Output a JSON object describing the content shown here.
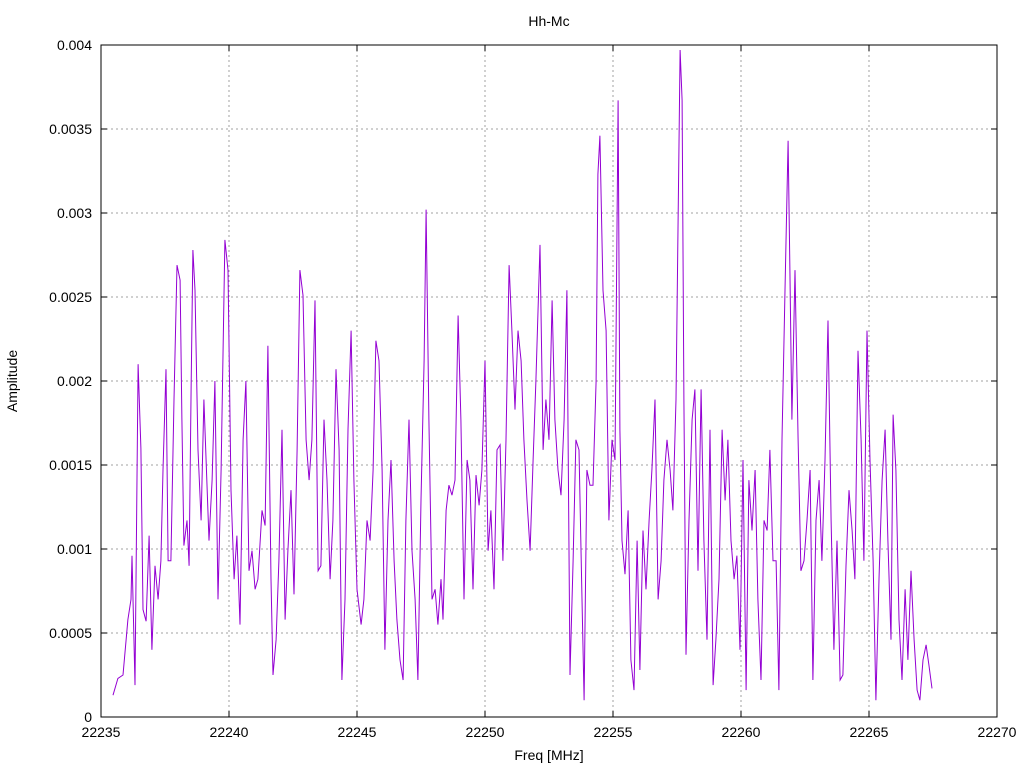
{
  "chart_data": {
    "type": "line",
    "title": "Hh-Mc",
    "xlabel": "Freq [MHz]",
    "ylabel": "Amplitude",
    "xlim": [
      22235,
      22270
    ],
    "ylim": [
      0,
      0.004
    ],
    "xticks": [
      22235,
      22240,
      22245,
      22250,
      22255,
      22260,
      22265,
      22270
    ],
    "yticks": [
      "0",
      "0.0005",
      "0.001",
      "0.0015",
      "0.002",
      "0.0025",
      "0.003",
      "0.0035",
      "0.004"
    ],
    "grid": true,
    "line_color": "#9400d3",
    "series": [
      {
        "name": "Hh-Mc",
        "x": [
          22235.47,
          22235.66,
          22235.86,
          22236.05,
          22236.17,
          22236.21,
          22236.33,
          22236.45,
          22236.56,
          22236.64,
          22236.76,
          22236.88,
          22236.99,
          22237.11,
          22237.23,
          22237.34,
          22237.42,
          22237.54,
          22237.62,
          22237.73,
          22237.85,
          22237.97,
          22238.09,
          22238.16,
          22238.24,
          22238.36,
          22238.44,
          22238.52,
          22238.59,
          22238.67,
          22238.79,
          22238.91,
          22239.02,
          22239.14,
          22239.22,
          22239.34,
          22239.45,
          22239.57,
          22239.69,
          22239.84,
          22239.96,
          22240.08,
          22240.2,
          22240.31,
          22240.43,
          22240.55,
          22240.66,
          22240.78,
          22240.9,
          22241.02,
          22241.13,
          22241.29,
          22241.41,
          22241.52,
          22241.64,
          22241.72,
          22241.84,
          22241.95,
          22242.07,
          22242.19,
          22242.3,
          22242.42,
          22242.54,
          22242.66,
          22242.77,
          22242.89,
          22243.01,
          22243.13,
          22243.24,
          22243.36,
          22243.48,
          22243.59,
          22243.71,
          22243.83,
          22243.95,
          22244.06,
          22244.18,
          22244.3,
          22244.41,
          22244.53,
          22244.65,
          22244.77,
          22244.88,
          22245.0,
          22245.16,
          22245.27,
          22245.39,
          22245.51,
          22245.63,
          22245.74,
          22245.86,
          22245.98,
          22246.09,
          22246.21,
          22246.33,
          22246.45,
          22246.56,
          22246.68,
          22246.8,
          22246.91,
          22247.03,
          22247.15,
          22247.27,
          22247.38,
          22247.5,
          22247.62,
          22247.7,
          22247.81,
          22247.93,
          22248.05,
          22248.16,
          22248.28,
          22248.36,
          22248.48,
          22248.59,
          22248.71,
          22248.83,
          22248.95,
          22249.06,
          22249.18,
          22249.3,
          22249.41,
          22249.53,
          22249.65,
          22249.77,
          22249.88,
          22250.0,
          22250.12,
          22250.23,
          22250.35,
          22250.47,
          22250.59,
          22250.7,
          22250.82,
          22250.94,
          22251.05,
          22251.17,
          22251.29,
          22251.41,
          22251.52,
          22251.64,
          22251.76,
          22251.88,
          22251.99,
          22252.15,
          22252.27,
          22252.38,
          22252.5,
          22252.62,
          22252.73,
          22252.85,
          22252.97,
          22253.09,
          22253.2,
          22253.32,
          22253.44,
          22253.55,
          22253.67,
          22253.79,
          22253.87,
          22253.98,
          22254.1,
          22254.22,
          22254.34,
          22254.41,
          22254.49,
          22254.61,
          22254.73,
          22254.84,
          22254.96,
          22255.08,
          22255.2,
          22255.27,
          22255.35,
          22255.47,
          22255.59,
          22255.7,
          22255.82,
          22255.94,
          22256.05,
          22256.17,
          22256.29,
          22256.41,
          22256.52,
          22256.64,
          22256.76,
          22256.88,
          22256.99,
          22257.11,
          22257.23,
          22257.34,
          22257.46,
          22257.62,
          22257.7,
          22257.77,
          22257.85,
          22257.97,
          22258.09,
          22258.2,
          22258.32,
          22258.44,
          22258.55,
          22258.67,
          22258.79,
          22258.91,
          22259.02,
          22259.14,
          22259.26,
          22259.38,
          22259.49,
          22259.61,
          22259.73,
          22259.84,
          22259.96,
          22260.08,
          22260.2,
          22260.31,
          22260.43,
          22260.55,
          22260.66,
          22260.78,
          22260.9,
          22261.02,
          22261.13,
          22261.25,
          22261.37,
          22261.48,
          22261.6,
          22261.72,
          22261.84,
          22261.91,
          22261.99,
          22262.11,
          22262.23,
          22262.34,
          22262.46,
          22262.58,
          22262.7,
          22262.81,
          22262.93,
          22263.05,
          22263.16,
          22263.28,
          22263.4,
          22263.52,
          22263.63,
          22263.75,
          22263.87,
          22263.98,
          22264.1,
          22264.22,
          22264.34,
          22264.45,
          22264.57,
          22264.69,
          22264.8,
          22264.92,
          22265.04,
          22265.16,
          22265.27,
          22265.39,
          22265.51,
          22265.63,
          22265.74,
          22265.86,
          22265.94,
          22266.05,
          22266.17,
          22266.29,
          22266.41,
          22266.52,
          22266.64,
          22266.76,
          22266.88,
          22266.99,
          22267.11,
          22267.23,
          22267.34,
          22267.46
        ],
        "y": [
          0.00013,
          0.00023,
          0.00025,
          0.00058,
          0.0007,
          0.00096,
          0.00019,
          0.0021,
          0.0016,
          0.00064,
          0.00057,
          0.00108,
          0.0004,
          0.0009,
          0.0007,
          0.00093,
          0.00147,
          0.00207,
          0.00093,
          0.00093,
          0.00189,
          0.00269,
          0.0026,
          0.00177,
          0.00102,
          0.00117,
          0.0009,
          0.00195,
          0.00278,
          0.00254,
          0.00159,
          0.00117,
          0.00189,
          0.00138,
          0.00105,
          0.00141,
          0.002,
          0.0007,
          0.00147,
          0.00284,
          0.00266,
          0.00135,
          0.00082,
          0.00108,
          0.00055,
          0.00165,
          0.002,
          0.00087,
          0.00099,
          0.00076,
          0.00082,
          0.00123,
          0.00114,
          0.00221,
          0.00082,
          0.00025,
          0.00046,
          0.00093,
          0.00171,
          0.00058,
          0.00099,
          0.00135,
          0.00073,
          0.00159,
          0.00266,
          0.00251,
          0.00165,
          0.00141,
          0.00165,
          0.00248,
          0.00087,
          0.0009,
          0.00177,
          0.00141,
          0.00082,
          0.00117,
          0.00207,
          0.00159,
          0.00022,
          0.0007,
          0.00171,
          0.0023,
          0.00141,
          0.00076,
          0.00055,
          0.0007,
          0.00117,
          0.00105,
          0.00147,
          0.00224,
          0.00212,
          0.00147,
          0.0004,
          0.00117,
          0.00153,
          0.00093,
          0.00058,
          0.00034,
          0.00022,
          0.00117,
          0.00177,
          0.00099,
          0.0007,
          0.00022,
          0.00129,
          0.00212,
          0.00302,
          0.00177,
          0.0007,
          0.00076,
          0.00055,
          0.00082,
          0.00058,
          0.00123,
          0.00138,
          0.00132,
          0.00141,
          0.00239,
          0.00177,
          0.0007,
          0.00153,
          0.00141,
          0.00076,
          0.00144,
          0.00126,
          0.00147,
          0.00212,
          0.00099,
          0.00123,
          0.00076,
          0.00159,
          0.00162,
          0.00093,
          0.00165,
          0.00269,
          0.0023,
          0.00183,
          0.0023,
          0.00212,
          0.00165,
          0.00129,
          0.00099,
          0.00153,
          0.002,
          0.00281,
          0.00159,
          0.00189,
          0.00165,
          0.00248,
          0.00177,
          0.00147,
          0.00132,
          0.00177,
          0.00254,
          0.00025,
          0.00093,
          0.00165,
          0.00159,
          0.0007,
          0.0001,
          0.00147,
          0.00138,
          0.00138,
          0.002,
          0.00323,
          0.00346,
          0.00254,
          0.0023,
          0.00117,
          0.00165,
          0.00153,
          0.00367,
          0.00171,
          0.00105,
          0.00085,
          0.00123,
          0.00034,
          0.00016,
          0.00105,
          0.00028,
          0.00111,
          0.00076,
          0.00117,
          0.00147,
          0.00189,
          0.0007,
          0.00093,
          0.00141,
          0.00165,
          0.00147,
          0.00123,
          0.00189,
          0.00397,
          0.00367,
          0.00189,
          0.00037,
          0.00117,
          0.00177,
          0.00195,
          0.00087,
          0.00195,
          0.00105,
          0.00046,
          0.00171,
          0.00019,
          0.00046,
          0.00082,
          0.00171,
          0.00129,
          0.00165,
          0.00105,
          0.00082,
          0.00096,
          0.0004,
          0.00153,
          0.00016,
          0.00141,
          0.00111,
          0.00147,
          0.0007,
          0.00022,
          0.00117,
          0.00111,
          0.00159,
          0.00093,
          0.00093,
          0.00016,
          0.00165,
          0.00254,
          0.00343,
          0.00266,
          0.00177,
          0.00266,
          0.00165,
          0.00087,
          0.00093,
          0.00117,
          0.00147,
          0.00022,
          0.00117,
          0.00141,
          0.00093,
          0.00153,
          0.00236,
          0.00117,
          0.0004,
          0.00105,
          0.00022,
          0.00025,
          0.0009,
          0.00135,
          0.00111,
          0.00082,
          0.00218,
          0.00165,
          0.00093,
          0.0023,
          0.00153,
          0.00093,
          0.0001,
          0.00082,
          0.00141,
          0.00171,
          0.00105,
          0.00046,
          0.0018,
          0.00147,
          0.00058,
          0.00022,
          0.00076,
          0.00034,
          0.00087,
          0.00046,
          0.00016,
          0.0001,
          0.00034,
          0.00043,
          0.00031,
          0.00017
        ]
      }
    ]
  }
}
